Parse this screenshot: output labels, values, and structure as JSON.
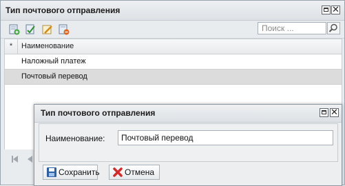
{
  "window": {
    "title": "Тип почтового отправления"
  },
  "toolbar": {
    "icons": [
      "add-icon",
      "edit-icon",
      "edit-form-icon",
      "delete-icon"
    ]
  },
  "search": {
    "placeholder": "Поиск ..."
  },
  "grid": {
    "corner": "*",
    "column_header": "Наименование",
    "rows": [
      {
        "name": "Наложный платеж",
        "selected": false
      },
      {
        "name": "Почтовый перевод",
        "selected": true
      }
    ]
  },
  "dialog": {
    "title": "Тип почтового отправления",
    "field_label": "Наименование:",
    "field_value": "Почтовый перевод",
    "save_label": "Сохранить",
    "cancel_label": "Отмена"
  },
  "colors": {
    "selected_row": "#dcdcdc",
    "cancel_icon": "#d62a2a",
    "save_icon": "#2c5fa8"
  }
}
